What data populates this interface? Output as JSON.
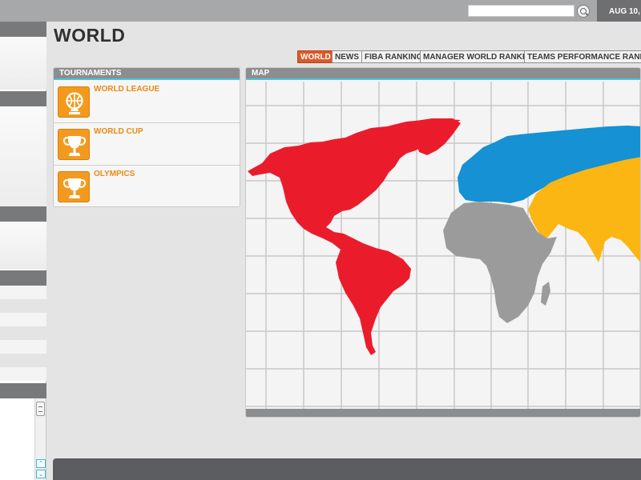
{
  "header": {
    "search_placeholder": "",
    "search_icon": "magnifier-icon",
    "date": "AUG 10, 2"
  },
  "page": {
    "title": "WORLD"
  },
  "nav_tabs": [
    {
      "label": "WORLD",
      "active": true
    },
    {
      "label": "NEWS",
      "active": false
    },
    {
      "label": "FIBA RANKING",
      "active": false
    },
    {
      "label": "MANAGER WORLD RANKING",
      "active": false
    },
    {
      "label": "TEAMS PERFORMANCE RANKING",
      "active": false
    }
  ],
  "tournaments": {
    "title": "TOURNAMENTS",
    "items": [
      {
        "label": "WORLD LEAGUE",
        "icon": "basketball-trophy-icon"
      },
      {
        "label": "WORLD CUP",
        "icon": "trophy-cup-icon"
      },
      {
        "label": "OLYMPICS",
        "icon": "trophy-cup-icon"
      }
    ]
  },
  "map": {
    "title": "MAP",
    "regions": [
      {
        "name": "americas",
        "color": "#ea1c2c"
      },
      {
        "name": "europe",
        "color": "#1591d4"
      },
      {
        "name": "africa",
        "color": "#9b9b9b"
      },
      {
        "name": "asia",
        "color": "#fbb613"
      }
    ]
  },
  "colors": {
    "accent": "#dc5a28",
    "tournament_orange": "#f39a1e",
    "panel_header": "#8c8d8f",
    "header_underline": "#4ec3d6"
  }
}
